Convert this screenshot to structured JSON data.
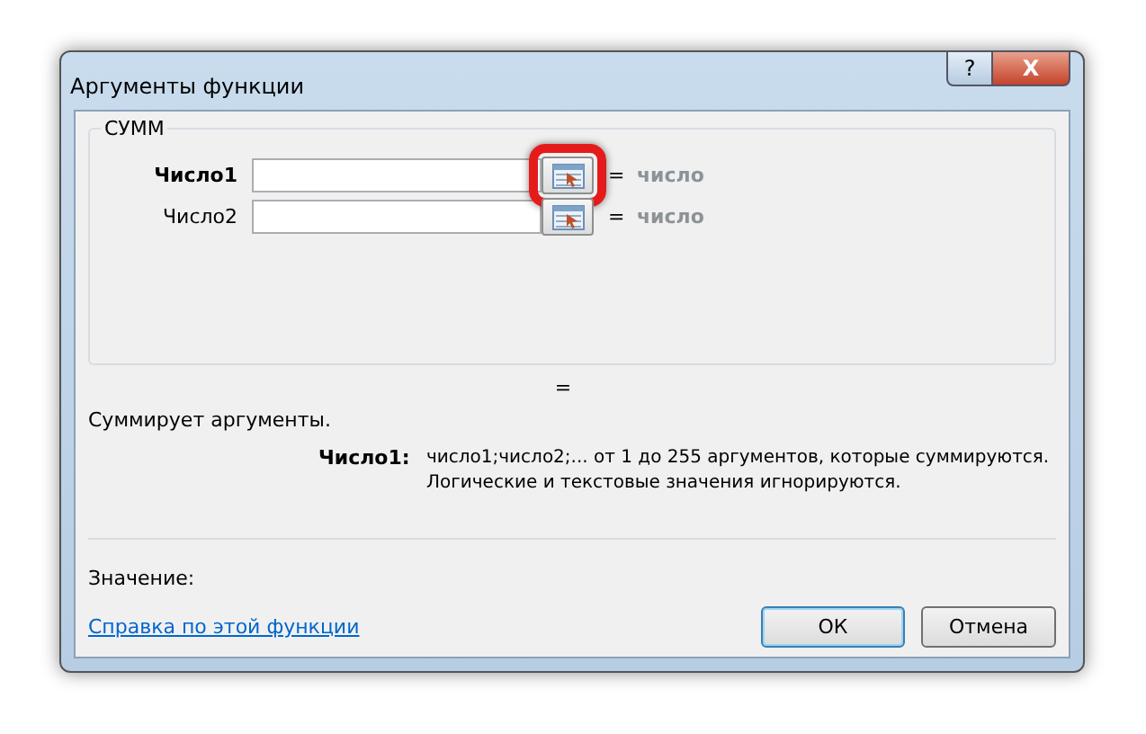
{
  "window": {
    "title": "Аргументы функции",
    "help_button": "?",
    "close_button": "X"
  },
  "function": {
    "name": "СУММ",
    "arguments": [
      {
        "label": "Число1",
        "bold": true,
        "highlighted": true,
        "equals": "=",
        "result": "число"
      },
      {
        "label": "Число2",
        "bold": false,
        "highlighted": false,
        "equals": "=",
        "result": "число"
      }
    ],
    "total_equals": "="
  },
  "description": "Суммирует аргументы.",
  "argument_help": {
    "label": "Число1:",
    "lines": [
      "число1;число2;... от 1 до 255 аргументов, которые суммируются.",
      "Логические и текстовые значения игнорируются."
    ]
  },
  "value_label": "Значение:",
  "help_link": "Справка по этой функции",
  "buttons": [
    {
      "label": "ОК",
      "kind": "default"
    },
    {
      "label": "Отмена",
      "kind": "normal"
    }
  ]
}
